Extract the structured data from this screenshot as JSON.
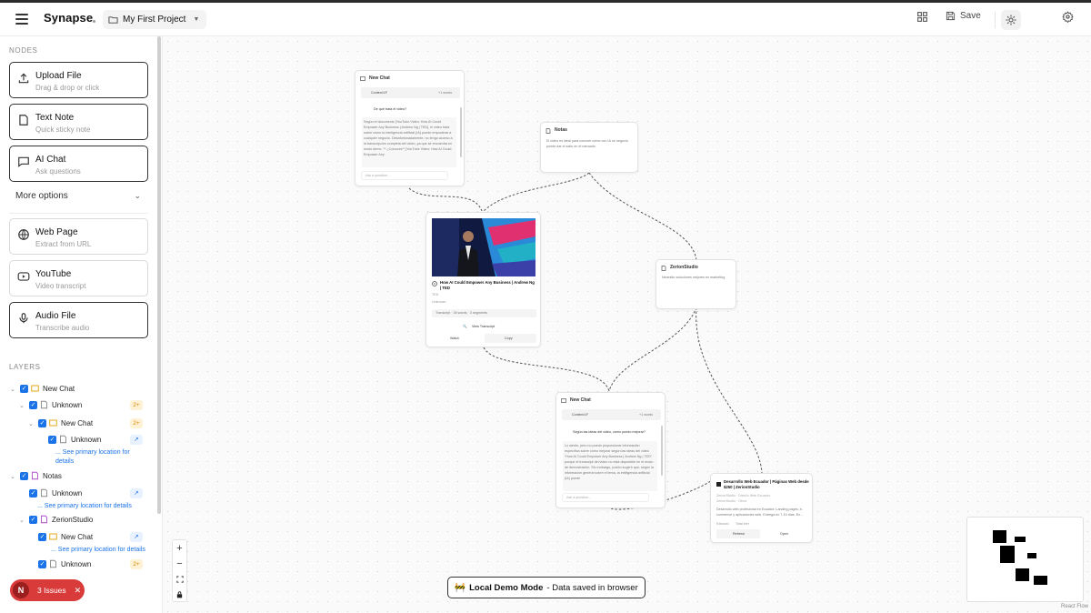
{
  "header": {
    "brand": "Synapse",
    "project": "My First Project",
    "save_label": "Save"
  },
  "sidebar": {
    "nodes_title": "NODES",
    "node_cards": [
      {
        "title": "Upload File",
        "subtitle": "Drag & drop or click",
        "icon": "upload-icon"
      },
      {
        "title": "Text Note",
        "subtitle": "Quick sticky note",
        "icon": "note-icon"
      },
      {
        "title": "AI Chat",
        "subtitle": "Ask questions",
        "icon": "chat-icon"
      }
    ],
    "more_options": "More options",
    "extra_cards": [
      {
        "title": "Web Page",
        "subtitle": "Extract from URL",
        "icon": "globe-icon"
      },
      {
        "title": "YouTube",
        "subtitle": "Video transcript",
        "icon": "youtube-icon"
      },
      {
        "title": "Audio File",
        "subtitle": "Transcribe audio",
        "icon": "mic-icon"
      }
    ],
    "layers_title": "LAYERS",
    "layers": [
      {
        "label": "New Chat",
        "badge": "",
        "type": "chat"
      },
      {
        "label": "Unknown",
        "badge": "2+",
        "type": "doc"
      },
      {
        "label": "New Chat",
        "badge": "2+",
        "type": "chat"
      },
      {
        "label": "Unknown",
        "badge": "↗",
        "type": "doc"
      },
      {
        "label": "Notas",
        "badge": "",
        "type": "note"
      },
      {
        "label": "Unknown",
        "badge": "↗",
        "type": "doc"
      },
      {
        "label": "ZerionStudio",
        "badge": "",
        "type": "note"
      },
      {
        "label": "New Chat",
        "badge": "↗",
        "type": "chat"
      },
      {
        "label": "Unknown",
        "badge": "2+",
        "type": "doc"
      }
    ],
    "see_primary": "... See primary location for details",
    "see_primary_1": "... See primary location for",
    "see_primary_2": "details"
  },
  "issues": {
    "label": "3 Issues",
    "avatar": "N"
  },
  "canvas": {
    "chat1": {
      "title": "New Chat",
      "context": "Context:1F",
      "context_right": "+1 words",
      "question": "De qué trata el video?",
      "answer": "Según el documento [YouTube Video: How AI Could Empower Any Business | Andrew Ng | TED], el video trata sobre cómo la inteligencia artificial (IA) puede empoderar a cualquier negocio. Desafortunadamente, no tengo acceso a la transcripción completa del video, ya que se encuentra en modo demo. ** ¿Conoces** [YouTube Video: How AI Could Empower Any",
      "placeholder": "Ask a question..."
    },
    "notas": {
      "title": "Notas",
      "text": "El video es ideal para conocer cómo con IA un negocio puede dar el salto en el mercado"
    },
    "zerion": {
      "title": "ZerionStudio",
      "text": "Necesito soluciones mejores en marketing"
    },
    "video": {
      "title": "How AI Could Empower Any Business | Andrew Ng | TED",
      "channel": "TED",
      "status": "Unknown",
      "stats": "Transcript · 36 words · 3 segments",
      "view_transcript": "View Transcript",
      "btn_left": "Watch",
      "btn_right": "Copy"
    },
    "chat2": {
      "title": "New Chat",
      "context": "Context:1F",
      "context_right": "+1 words",
      "question": "Según las ideas del video, cómo puedo mejorar?",
      "answer": "Lo siento, pero no puedo proporcionar información específica sobre cómo mejorar según las ideas del video \"How AI Could Empower Any Business | Andrew Ng | TED\" porque el transcript del video no está disponible en el modo de demostración. Sin embargo, puedo sugerir que, según la información general sobre el tema, la inteligencia artificial (IA) puede",
      "placeholder": "Ask a question..."
    },
    "web": {
      "title": "Desarrollo Web Ecuador | Páginas Web desde $250 | ZerionStudio",
      "site": "ZerionStudio · Diseño Web Ecuador",
      "meta": "ZerionStudio · Otros",
      "desc": "Desarrollo web profesional en Ecuador. Landing pages, e-commerce y aplicaciones web. Entrega en 7-10 días. En...",
      "status_left": "Extracto",
      "status_right": "Total leer",
      "btn_left": "Refresh",
      "btn_right": "Open"
    }
  },
  "demo_banner": {
    "emoji": "🚧",
    "bold": "Local Demo Mode",
    "rest": "- Data saved in browser"
  },
  "attribution": "React Flow",
  "colors": {
    "accent": "#1a73e8",
    "issue_red": "#d93a3a",
    "edge": "#555555"
  }
}
